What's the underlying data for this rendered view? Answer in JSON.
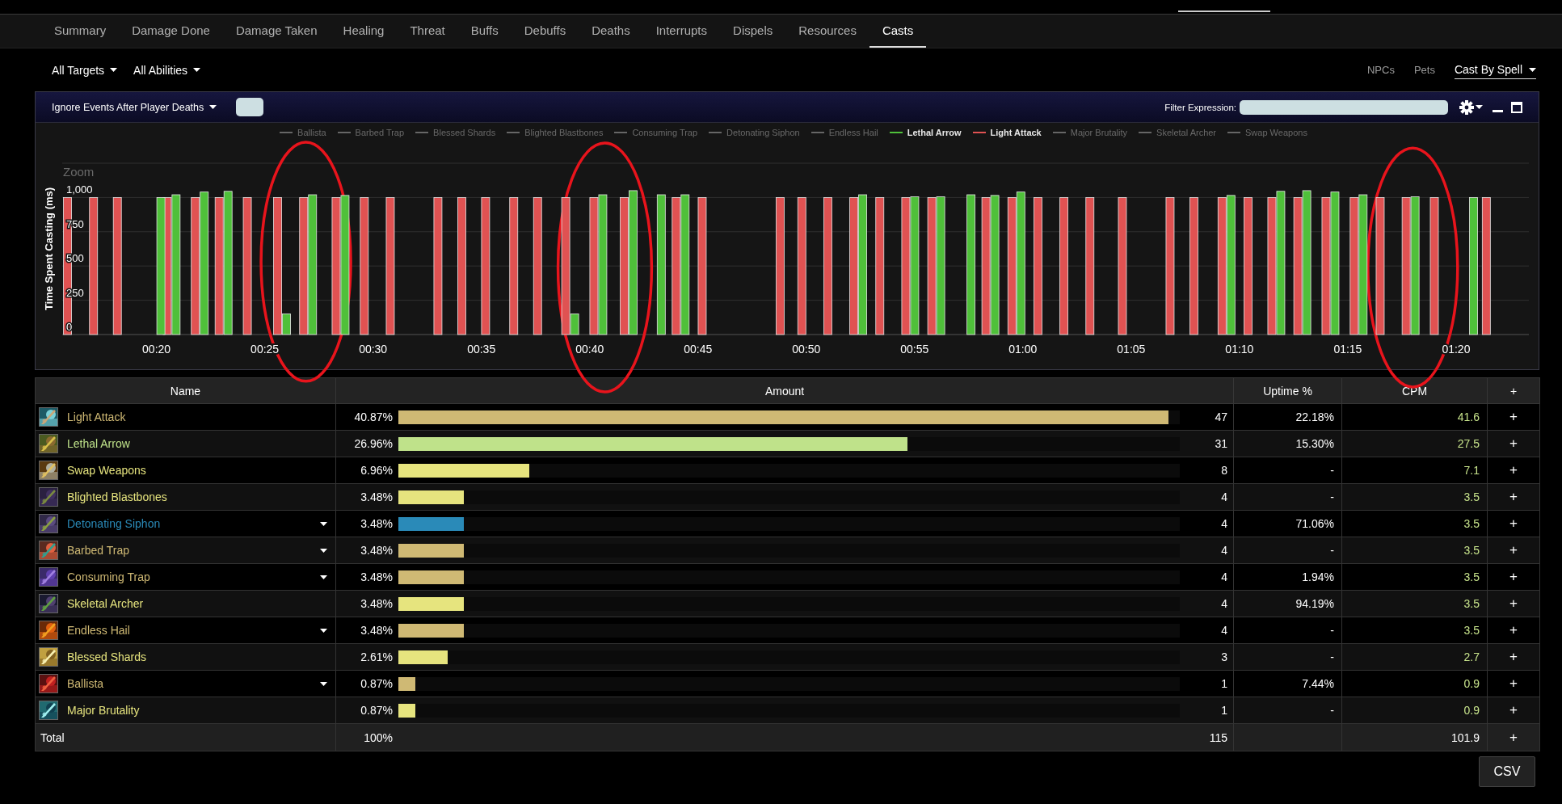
{
  "tabs": [
    {
      "label": "Summary",
      "selected": false
    },
    {
      "label": "Damage Done",
      "selected": false
    },
    {
      "label": "Damage Taken",
      "selected": false
    },
    {
      "label": "Healing",
      "selected": false
    },
    {
      "label": "Threat",
      "selected": false
    },
    {
      "label": "Buffs",
      "selected": false
    },
    {
      "label": "Debuffs",
      "selected": false
    },
    {
      "label": "Deaths",
      "selected": false
    },
    {
      "label": "Interrupts",
      "selected": false
    },
    {
      "label": "Dispels",
      "selected": false
    },
    {
      "label": "Resources",
      "selected": false
    },
    {
      "label": "Casts",
      "selected": true
    }
  ],
  "filters": {
    "targets": "All Targets",
    "abilities": "All Abilities",
    "view_options": [
      {
        "label": "NPCs",
        "selected": false
      },
      {
        "label": "Pets",
        "selected": false
      },
      {
        "label": "Cast By Spell",
        "selected": true
      }
    ]
  },
  "chart_panel": {
    "death_filter": "Ignore Events After Player Deaths",
    "filter_label": "Filter Expression:",
    "zoom_label": "Zoom",
    "legend": [
      {
        "label": "Ballista",
        "visible": false
      },
      {
        "label": "Barbed Trap",
        "visible": false
      },
      {
        "label": "Blessed Shards",
        "visible": false
      },
      {
        "label": "Blighted Blastbones",
        "visible": false
      },
      {
        "label": "Consuming Trap",
        "visible": false
      },
      {
        "label": "Detonating Siphon",
        "visible": false
      },
      {
        "label": "Endless Hail",
        "visible": false
      },
      {
        "visible": true
      },
      {
        "visible": true
      },
      {
        "label": "Major Brutality",
        "visible": false
      },
      {
        "label": "Skeletal Archer",
        "visible": false
      },
      {
        "label": "Swap Weapons",
        "visible": false
      }
    ],
    "chart_data": {
      "type": "bar",
      "grid": true,
      "ylabel": "Time Spent Casting (ms)",
      "xlim": [
        15.65,
        83.36
      ],
      "ylim": [
        0,
        1250
      ],
      "x": [
        16.1,
        17.3,
        18.4,
        20.0,
        20.7,
        22.0,
        23.1,
        24.4,
        25.8,
        27.0,
        28.5,
        29.8,
        31.0,
        33.2,
        34.3,
        35.4,
        36.7,
        37.8,
        39.1,
        40.4,
        41.8,
        43.1,
        44.2,
        45.4,
        49.0,
        50.0,
        51.2,
        52.4,
        53.6,
        54.8,
        56.0,
        57.4,
        58.5,
        59.7,
        60.9,
        62.1,
        63.3,
        64.8,
        67.0,
        68.1,
        69.4,
        70.6,
        71.7,
        72.9,
        74.2,
        75.5,
        76.7,
        77.9,
        79.2,
        80.6,
        81.6
      ],
      "xticks": [
        {
          "value": 20,
          "label": "00:20"
        },
        {
          "value": 25,
          "label": "00:25"
        },
        {
          "value": 30,
          "label": "00:30"
        },
        {
          "value": 35,
          "label": "00:35"
        },
        {
          "value": 40,
          "label": "00:40"
        },
        {
          "value": 45,
          "label": "00:45"
        },
        {
          "value": 50,
          "label": "00:50"
        },
        {
          "value": 55,
          "label": "00:55"
        },
        {
          "value": 60,
          "label": "01:00"
        },
        {
          "value": 65,
          "label": "01:05"
        },
        {
          "value": 70,
          "label": "01:10"
        },
        {
          "value": 75,
          "label": "01:15"
        },
        {
          "value": 80,
          "label": "01:20"
        }
      ],
      "yticks": [
        0,
        250,
        500,
        750,
        {
          "value": 1000,
          "label": "1,000"
        }
      ],
      "series": [
        {
          "name": "Lethal Arrow",
          "color": "#4fc03a",
          "values": [
            null,
            null,
            null,
            1000,
            1020,
            1040,
            1045,
            null,
            150,
            1020,
            1015,
            null,
            null,
            null,
            null,
            null,
            null,
            null,
            150,
            1020,
            1050,
            1020,
            1020,
            null,
            null,
            null,
            null,
            1020,
            null,
            1005,
            1005,
            1020,
            1015,
            1040,
            null,
            null,
            null,
            null,
            null,
            null,
            1015,
            null,
            1045,
            1050,
            1040,
            1020,
            null,
            1005,
            null,
            1000,
            null
          ]
        },
        {
          "name": "Light Attack",
          "color": "#e05252",
          "values": [
            1000,
            1000,
            1000,
            null,
            1000,
            1000,
            1000,
            1000,
            1000,
            1000,
            1000,
            1000,
            1000,
            1000,
            1000,
            1000,
            1000,
            1000,
            1000,
            1000,
            1000,
            null,
            1000,
            1000,
            1000,
            1000,
            1000,
            1000,
            1000,
            1000,
            1000,
            null,
            1000,
            1000,
            1000,
            1000,
            1000,
            1000,
            1000,
            1000,
            1000,
            1000,
            1000,
            1000,
            1000,
            1000,
            1000,
            1000,
            1000,
            null,
            1000
          ]
        }
      ]
    }
  },
  "table": {
    "columns": [
      "Name",
      "Amount",
      "Uptime %",
      "CPM",
      "+"
    ],
    "rows": [
      {
        "name": "Light Attack",
        "color": "#cfb974",
        "expandable": false,
        "percent": "40.87%",
        "level": 0.9855,
        "count": "47",
        "uptime": "22.18%",
        "cpm": "41.6",
        "add": "+"
      },
      {
        "name": "Lethal Arrow",
        "color": "#bfe28a",
        "expandable": false,
        "percent": "26.96%",
        "level": 0.651,
        "count": "31",
        "uptime": "15.30%",
        "cpm": "27.5",
        "add": "+"
      },
      {
        "name": "Swap Weapons",
        "color": "#e6e47e",
        "expandable": false,
        "percent": "6.96%",
        "level": 0.168,
        "count": "8",
        "uptime": "-",
        "cpm": "7.1",
        "add": "+"
      },
      {
        "name": "Blighted Blastbones",
        "color": "#e6e47e",
        "expandable": false,
        "percent": "3.48%",
        "level": 0.0837,
        "count": "4",
        "uptime": "-",
        "cpm": "3.5",
        "add": "+"
      },
      {
        "name": "Detonating Siphon",
        "color": "#2a8ab8",
        "expandable": true,
        "percent": "3.48%",
        "level": 0.0837,
        "count": "4",
        "uptime": "71.06%",
        "cpm": "3.5",
        "add": "+"
      },
      {
        "name": "Barbed Trap",
        "color": "#cfb974",
        "expandable": true,
        "percent": "3.48%",
        "level": 0.0837,
        "count": "4",
        "uptime": "-",
        "cpm": "3.5",
        "add": "+"
      },
      {
        "name": "Consuming Trap",
        "color": "#cfb974",
        "expandable": true,
        "percent": "3.48%",
        "level": 0.0837,
        "count": "4",
        "uptime": "1.94%",
        "cpm": "3.5",
        "add": "+"
      },
      {
        "name": "Skeletal Archer",
        "color": "#e6e47e",
        "expandable": false,
        "percent": "3.48%",
        "level": 0.0837,
        "count": "4",
        "uptime": "94.19%",
        "cpm": "3.5",
        "add": "+"
      },
      {
        "name": "Endless Hail",
        "color": "#cfb974",
        "expandable": true,
        "percent": "3.48%",
        "level": 0.0837,
        "count": "4",
        "uptime": "-",
        "cpm": "3.5",
        "add": "+"
      },
      {
        "name": "Blessed Shards",
        "color": "#e6e47e",
        "expandable": false,
        "percent": "2.61%",
        "level": 0.0635,
        "count": "3",
        "uptime": "-",
        "cpm": "2.7",
        "add": "+"
      },
      {
        "name": "Ballista",
        "color": "#cfb974",
        "expandable": true,
        "percent": "0.87%",
        "level": 0.0217,
        "count": "1",
        "uptime": "7.44%",
        "cpm": "0.9",
        "add": "+"
      },
      {
        "name": "Major Brutality",
        "color": "#e6e47e",
        "expandable": false,
        "percent": "0.87%",
        "level": 0.0217,
        "count": "1",
        "uptime": "-",
        "cpm": "0.9",
        "add": "+"
      }
    ],
    "total": {
      "label": "Total",
      "percent": "100%",
      "count": "115",
      "cpm": "101.9",
      "add": "+"
    }
  },
  "export_button": "CSV"
}
